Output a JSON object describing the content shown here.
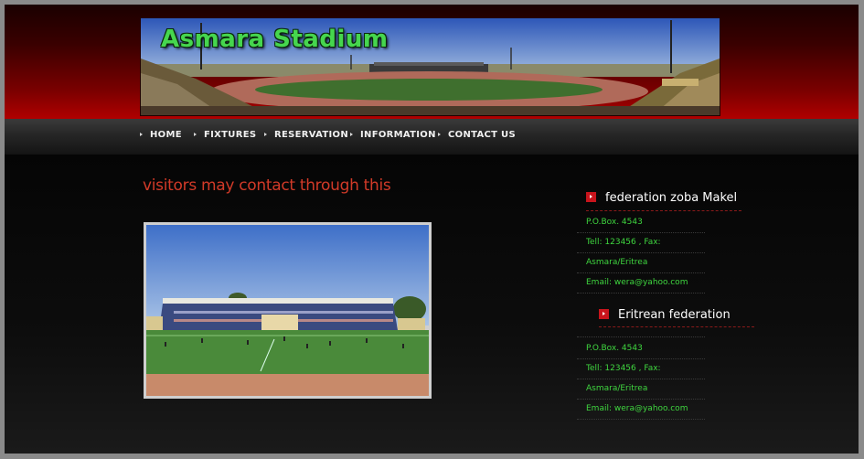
{
  "banner": {
    "title": "Asmara Stadium"
  },
  "nav": {
    "items": [
      {
        "label": "HOME"
      },
      {
        "label": "FIXTURES"
      },
      {
        "label": "RESERVATION"
      },
      {
        "label": "INFORMATION"
      },
      {
        "label": "CONTACT US"
      }
    ]
  },
  "main": {
    "heading": "visitors may contact through this"
  },
  "sidebar": {
    "sections": [
      {
        "title": "federation zoba Makel",
        "lines": [
          "P.O.Box. 4543",
          "Tell: 123456 , Fax:",
          "Asmara/Eritrea",
          "Email: wera@yahoo.com"
        ]
      },
      {
        "title": "Eritrean federation",
        "lines": [
          "P.O.Box. 4543",
          "Tell: 123456 , Fax:",
          "Asmara/Eritrea",
          "Email: wera@yahoo.com"
        ]
      }
    ]
  },
  "colors": {
    "header_red": "#b00000",
    "heading_red": "#d23a28",
    "contact_green": "#3fd63f",
    "banner_title_green": "#46d64e"
  }
}
